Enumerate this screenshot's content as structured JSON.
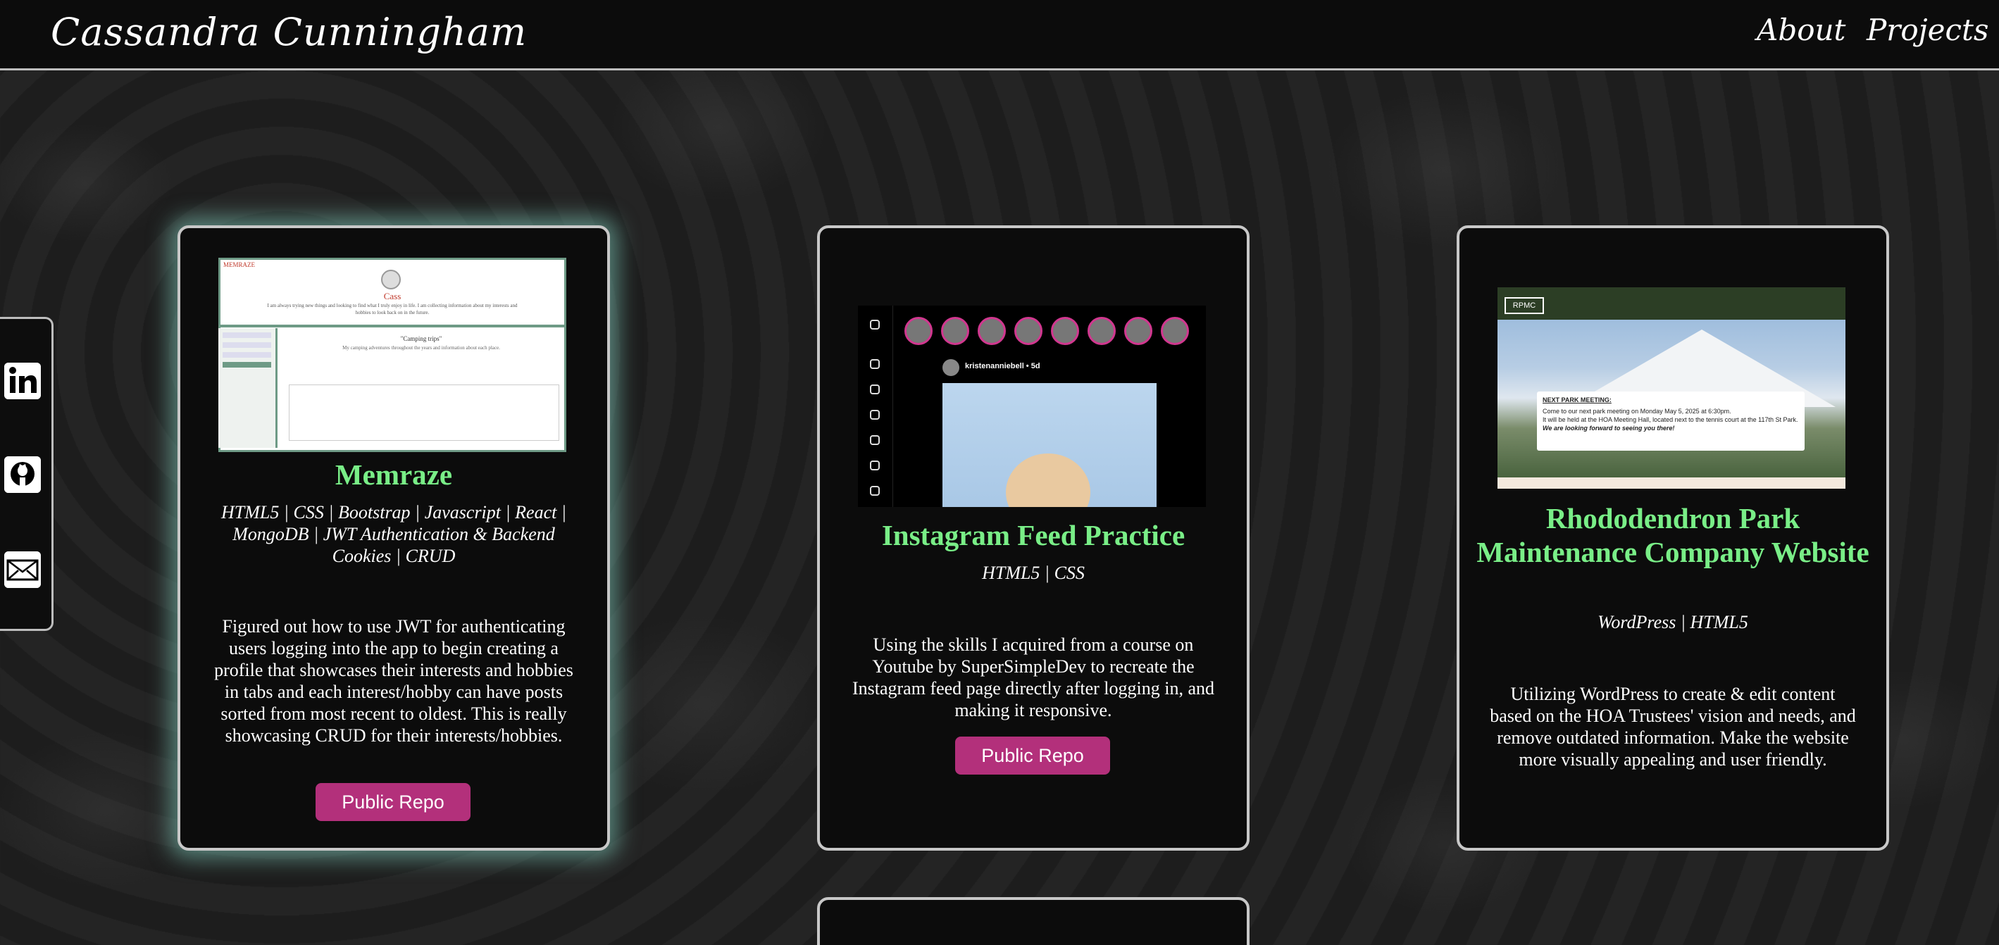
{
  "header": {
    "brand": "Cassandra Cunningham",
    "nav": [
      "About",
      "Projects"
    ]
  },
  "social": {
    "items": [
      {
        "name": "linkedin-icon"
      },
      {
        "name": "github-icon"
      },
      {
        "name": "email-icon"
      }
    ]
  },
  "projects": [
    {
      "title": "Memraze",
      "tech": "HTML5 | CSS | Bootstrap | Javascript | React | MongoDB | JWT Authentication & Backend Cookies | CRUD",
      "description": "Figured out how to use JWT for authenticating users logging into the app to begin creating a profile that showcases their interests and hobbies in tabs and each interest/hobby can have posts sorted from most recent to oldest. This is really showcasing CRUD for their interests/hobbies.",
      "button": "Public Repo",
      "thumb": {
        "logo": "MEMRAZE",
        "name": "Cass",
        "bio": "I am always trying new things and looking to find what I truly enjoy in life. I am collecting information about my interests and hobbies to look back on in the future.",
        "heading": "\"Camping trips\"",
        "sub": "My camping adventures throughout the years and information about each place."
      }
    },
    {
      "title": "Instagram Feed Practice",
      "tech": "HTML5 | CSS",
      "description": "Using the skills I acquired from a course on Youtube by SuperSimpleDev to recreate the Instagram feed page directly after logging in, and making it responsive.",
      "button": "Public Repo",
      "thumb": {
        "user": "kristenanniebell • 5d"
      }
    },
    {
      "title": "Rhododendron Park Maintenance Company Website",
      "tech": "WordPress | HTML5",
      "description": "Utilizing WordPress to create & edit content based on the HOA Trustees' vision and needs, and remove outdated information. Make the website more visually appealing and user friendly.",
      "button": null,
      "thumb": {
        "logo": "RPMC",
        "note_title": "NEXT PARK MEETING:",
        "note_line1": "Come to our next park meeting on Monday May 5, 2025 at 6:30pm.",
        "note_line2": "It will be held at the HOA Meeting Hall, located next to the tennis court at the 117th St Park.",
        "note_line3": "We are looking forward to seeing you there!"
      }
    }
  ],
  "colors": {
    "accent_green": "#79ee87",
    "button_pink": "#b3307b",
    "glow": "#82cdbe"
  }
}
